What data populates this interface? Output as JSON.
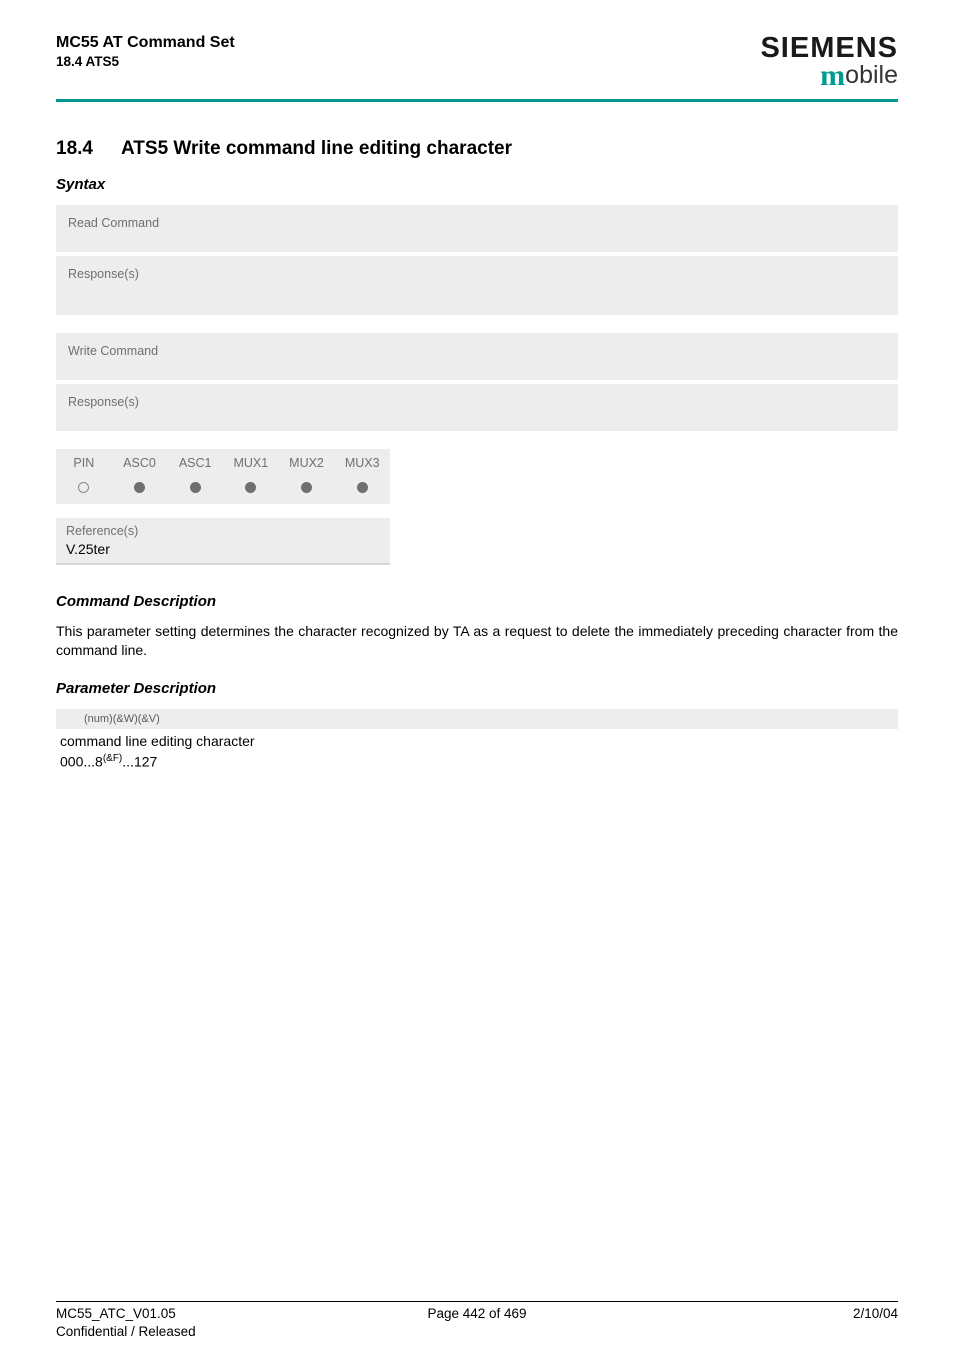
{
  "header": {
    "title_line1": "MC55 AT Command Set",
    "title_line2": "18.4 ATS5",
    "brand": "SIEMENS",
    "mobile_m": "m",
    "mobile_rest": "obile"
  },
  "section": {
    "number": "18.4",
    "title": "ATS5   Write command line editing character"
  },
  "syntax_label": "Syntax",
  "blocks": {
    "read_command": "Read Command",
    "response": "Response(s)",
    "write_command": "Write Command"
  },
  "interfaces": {
    "headers": [
      "PIN",
      "ASC0",
      "ASC1",
      "MUX1",
      "MUX2",
      "MUX3"
    ],
    "values": [
      "open",
      "fill",
      "fill",
      "fill",
      "fill",
      "fill"
    ]
  },
  "reference": {
    "label": "Reference(s)",
    "value": "V.25ter"
  },
  "cmd_desc": {
    "label": "Command Description",
    "text": "This parameter setting determines the character recognized by TA as a request to delete the immediately preceding character from the command line."
  },
  "param_desc": {
    "label": "Parameter Description",
    "bar": "(num)(&W)(&V)",
    "text": "command line editing character",
    "range_pre": "000...8",
    "range_sup": "(&F)",
    "range_post": "...127"
  },
  "footer": {
    "left": "MC55_ATC_V01.05",
    "center": "Page 442 of 469",
    "right": "2/10/04",
    "line2": "Confidential / Released"
  }
}
